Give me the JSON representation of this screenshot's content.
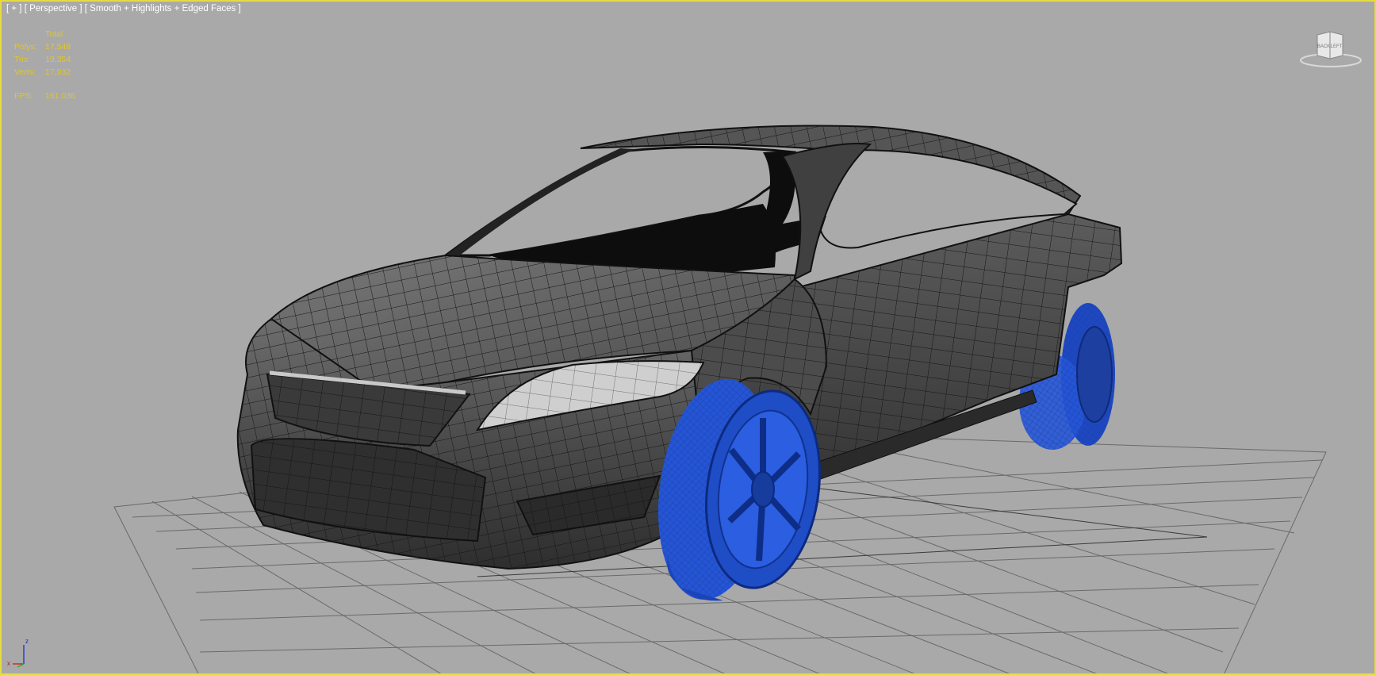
{
  "viewport": {
    "label_plus": "[ + ]",
    "label_view": "[ Perspective ]",
    "label_shading": "[ Smooth + Highlights + Edged Faces ]"
  },
  "stats": {
    "header": "Total",
    "polys_label": "Polys:",
    "polys_value": "17,548",
    "tris_label": "Tris:",
    "tris_value": "19,354",
    "verts_label": "Verts:",
    "verts_value": "17,932",
    "fps_label": "FPS:",
    "fps_value": "161.036"
  },
  "viewcube": {
    "front_label": "BACK",
    "side_label": "LEFT"
  },
  "axis_tripod": {
    "z_label": "z",
    "x_label": "x"
  },
  "colors": {
    "viewport_bg": "#a9a9a9",
    "active_border": "#e6dc3c",
    "stats_text": "#e0c62a",
    "wheel_wire": "#2a5bd6",
    "body_dark": "#3a3a3a"
  }
}
